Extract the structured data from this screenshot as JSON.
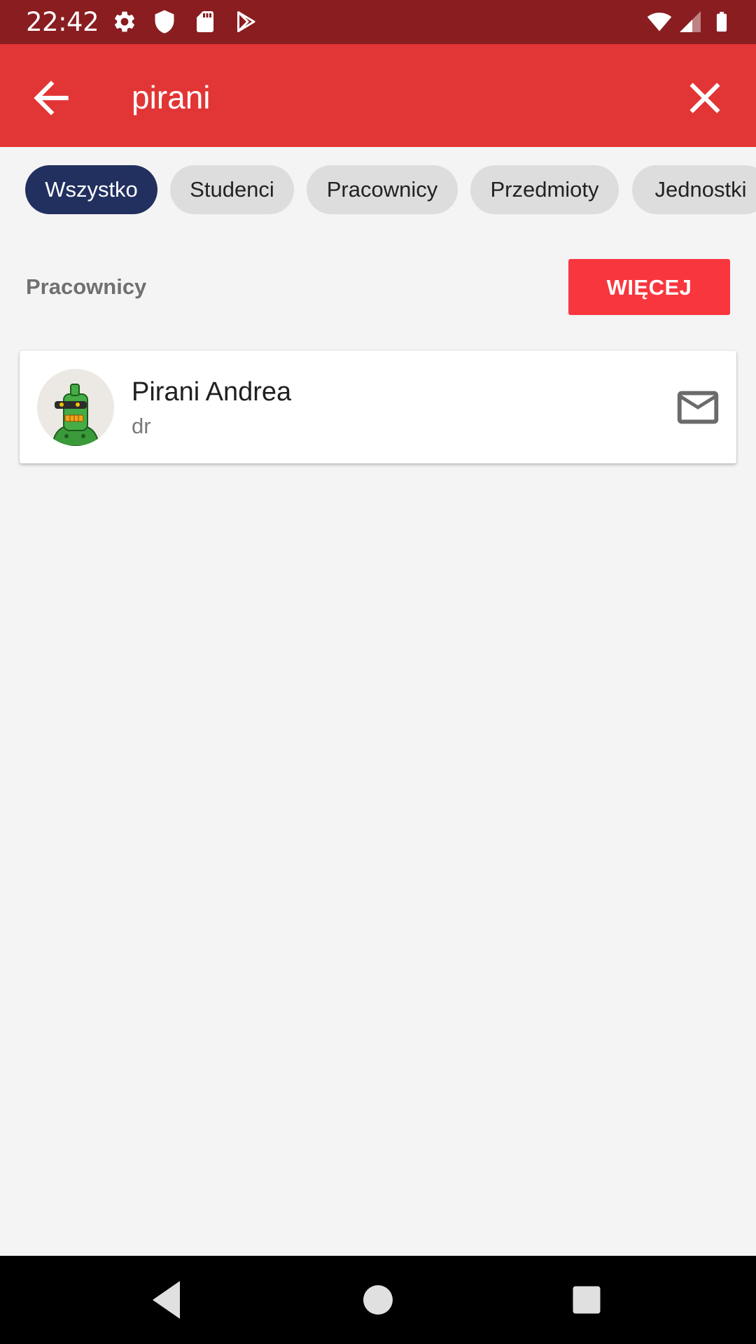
{
  "status_bar": {
    "time": "22:42",
    "left_icons": [
      "gear-icon",
      "shield-icon",
      "sd-card-icon",
      "play-store-icon"
    ],
    "right_icons": [
      "wifi-icon",
      "cell-signal-icon",
      "battery-icon"
    ]
  },
  "app_bar": {
    "back_icon": "arrow-back-icon",
    "search_value": "pirani",
    "clear_icon": "close-icon",
    "color": "#e23535"
  },
  "filters": [
    {
      "label": "Wszystko",
      "active": true
    },
    {
      "label": "Studenci",
      "active": false
    },
    {
      "label": "Pracownicy",
      "active": false
    },
    {
      "label": "Przedmioty",
      "active": false
    },
    {
      "label": "Jednostki",
      "active": false
    }
  ],
  "section": {
    "title": "Pracownicy",
    "more_label": "WIĘCEJ"
  },
  "results": [
    {
      "name": "Pirani Andrea",
      "title": "dr",
      "avatar_icon": "robot-avatar",
      "action_icon": "mail-icon"
    }
  ],
  "nav_bar": {
    "buttons": [
      "back-triangle-icon",
      "home-circle-icon",
      "recents-square-icon"
    ]
  },
  "colors": {
    "status_bar": "#891d20",
    "chip_active": "#223060",
    "more_button": "#f8363e"
  }
}
